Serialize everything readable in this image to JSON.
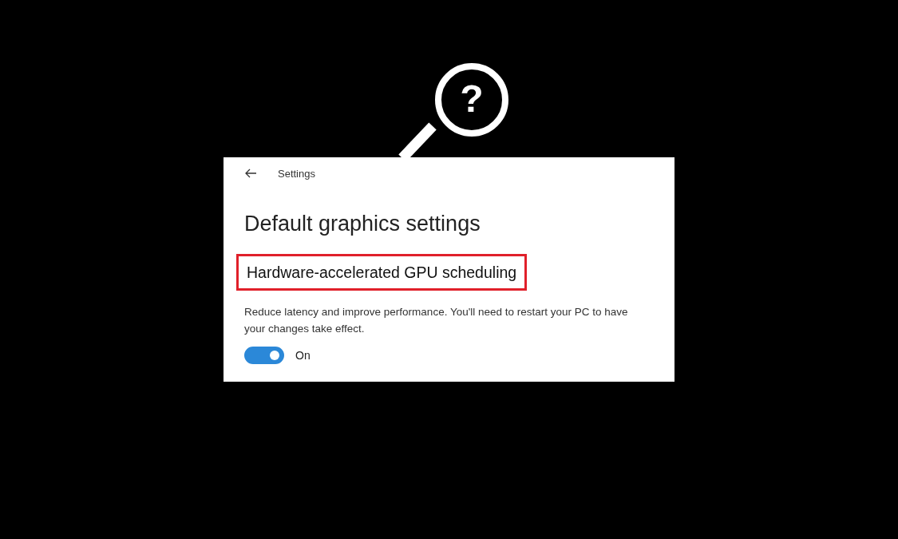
{
  "callout": {
    "symbol": "?"
  },
  "window": {
    "title": "Settings"
  },
  "page": {
    "heading": "Default graphics settings"
  },
  "setting": {
    "title": "Hardware-accelerated GPU scheduling",
    "highlighted": true,
    "description": "Reduce latency and improve performance. You'll need to restart your PC to have your changes take effect.",
    "toggle": {
      "on": true,
      "label": "On"
    }
  }
}
